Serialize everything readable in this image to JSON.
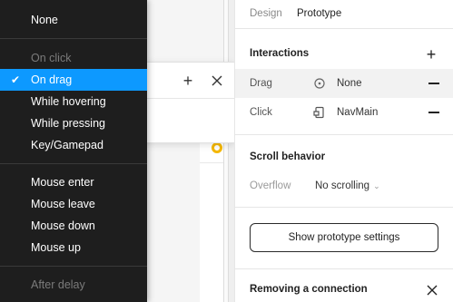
{
  "menu": {
    "items": [
      {
        "label": "None",
        "state": "normal"
      },
      {
        "label": "On click",
        "state": "disabled"
      },
      {
        "label": "On drag",
        "state": "selected"
      },
      {
        "label": "While hovering",
        "state": "normal"
      },
      {
        "label": "While pressing",
        "state": "normal"
      },
      {
        "label": "Key/Gamepad",
        "state": "normal"
      },
      {
        "label": "Mouse enter",
        "state": "normal"
      },
      {
        "label": "Mouse leave",
        "state": "normal"
      },
      {
        "label": "Mouse down",
        "state": "normal"
      },
      {
        "label": "Mouse up",
        "state": "normal"
      },
      {
        "label": "After delay",
        "state": "disabled"
      }
    ],
    "check_glyph": "✔",
    "selected_color": "#0d99ff"
  },
  "popover": {
    "add_icon": "plus-icon",
    "close_icon": "close-icon"
  },
  "panel": {
    "tabs": {
      "design": "Design",
      "prototype": "Prototype",
      "active": "prototype"
    },
    "interactions": {
      "title": "Interactions",
      "rows": [
        {
          "trigger": "Drag",
          "icon": "circle-dot-icon",
          "action": "None"
        },
        {
          "trigger": "Click",
          "icon": "navigate-frame-icon",
          "action": "NavMain"
        }
      ]
    },
    "scroll_behavior": {
      "title": "Scroll behavior",
      "overflow_label": "Overflow",
      "overflow_value": "No scrolling",
      "chevron": "⌄"
    },
    "prototype_settings_button": "Show prototype settings",
    "removing_connection": {
      "title": "Removing a connection"
    }
  }
}
